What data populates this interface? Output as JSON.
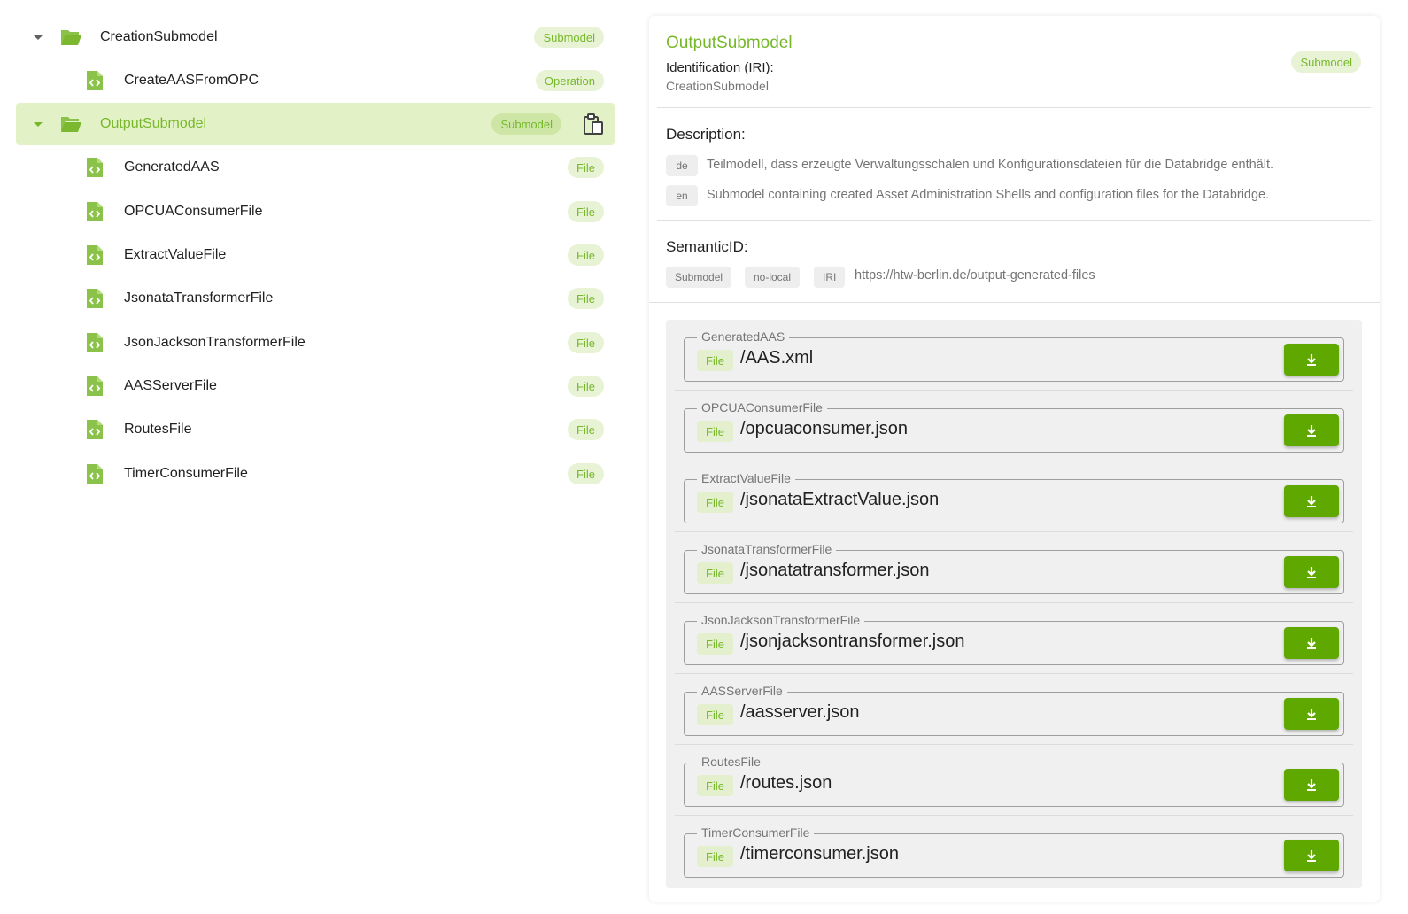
{
  "tree": {
    "nodes": [
      {
        "label": "CreationSubmodel",
        "badge": "Submodel",
        "icon": "folder-open-icon",
        "expanded": true,
        "level": 0
      },
      {
        "label": "CreateAASFromOPC",
        "badge": "Operation",
        "icon": "code-file-icon",
        "level": 1
      },
      {
        "label": "OutputSubmodel",
        "badge": "Submodel",
        "icon": "folder-open-icon",
        "expanded": true,
        "selected": true,
        "level": 0
      },
      {
        "label": "GeneratedAAS",
        "badge": "File",
        "icon": "code-file-icon",
        "level": 1
      },
      {
        "label": "OPCUAConsumerFile",
        "badge": "File",
        "icon": "code-file-icon",
        "level": 1
      },
      {
        "label": "ExtractValueFile",
        "badge": "File",
        "icon": "code-file-icon",
        "level": 1
      },
      {
        "label": "JsonataTransformerFile",
        "badge": "File",
        "icon": "code-file-icon",
        "level": 1
      },
      {
        "label": "JsonJacksonTransformerFile",
        "badge": "File",
        "icon": "code-file-icon",
        "level": 1
      },
      {
        "label": "AASServerFile",
        "badge": "File",
        "icon": "code-file-icon",
        "level": 1
      },
      {
        "label": "RoutesFile",
        "badge": "File",
        "icon": "code-file-icon",
        "level": 1
      },
      {
        "label": "TimerConsumerFile",
        "badge": "File",
        "icon": "code-file-icon",
        "level": 1
      }
    ]
  },
  "detail": {
    "title": "OutputSubmodel",
    "badge": "Submodel",
    "id_label": "Identification (IRI):",
    "id_value": "CreationSubmodel",
    "description_label": "Description:",
    "descriptions": [
      {
        "lang": "de",
        "text": "Teilmodell, dass erzeugte Verwaltungsschalen und Konfigurationsdateien für die Databridge enthält."
      },
      {
        "lang": "en",
        "text": "Submodel containing created Asset Administration Shells and configuration files for the Databridge."
      }
    ],
    "semantic_label": "SemanticID:",
    "semantic_chips": [
      "Submodel",
      "no-local",
      "IRI"
    ],
    "semantic_url": "https://htw-berlin.de/output-generated-files",
    "files": [
      {
        "name": "GeneratedAAS",
        "type": "File",
        "path": "/AAS.xml"
      },
      {
        "name": "OPCUAConsumerFile",
        "type": "File",
        "path": "/opcuaconsumer.json"
      },
      {
        "name": "ExtractValueFile",
        "type": "File",
        "path": "/jsonataExtractValue.json"
      },
      {
        "name": "JsonataTransformerFile",
        "type": "File",
        "path": "/jsonatatransformer.json"
      },
      {
        "name": "JsonJacksonTransformerFile",
        "type": "File",
        "path": "/jsonjacksontransformer.json"
      },
      {
        "name": "AASServerFile",
        "type": "File",
        "path": "/aasserver.json"
      },
      {
        "name": "RoutesFile",
        "type": "File",
        "path": "/routes.json"
      },
      {
        "name": "TimerConsumerFile",
        "type": "File",
        "path": "/timerconsumer.json"
      }
    ]
  },
  "colors": {
    "accent": "#76b82a",
    "selected_row_bg": "#e3f2c6",
    "button": "#5fa800"
  }
}
